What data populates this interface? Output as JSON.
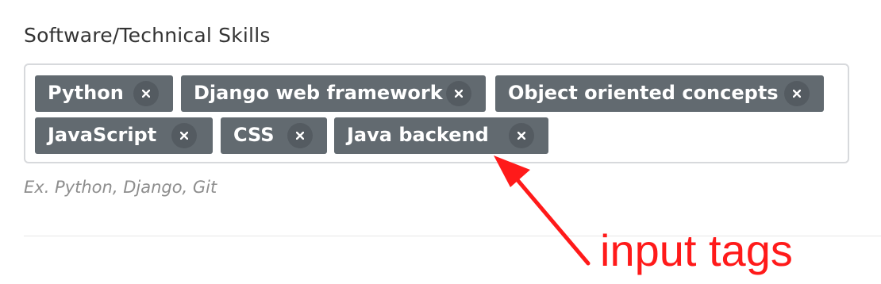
{
  "field": {
    "label": "Software/Technical Skills",
    "help_text": "Ex. Python, Django, Git"
  },
  "tags": [
    {
      "label": "Python",
      "remove_icon": "close-icon"
    },
    {
      "label": "Django web framework",
      "remove_icon": "close-icon"
    },
    {
      "label": "Object oriented concepts",
      "remove_icon": "close-icon"
    },
    {
      "label": "JavaScript",
      "remove_icon": "close-icon"
    },
    {
      "label": "CSS",
      "remove_icon": "close-icon"
    },
    {
      "label": "Java backend",
      "remove_icon": "close-icon"
    }
  ],
  "annotation": {
    "text": "input tags",
    "color": "#ff1a1a"
  },
  "colors": {
    "tag_background": "#626a70",
    "tag_text": "#ffffff",
    "label_text": "#333333",
    "help_text": "#8d8d8d"
  }
}
